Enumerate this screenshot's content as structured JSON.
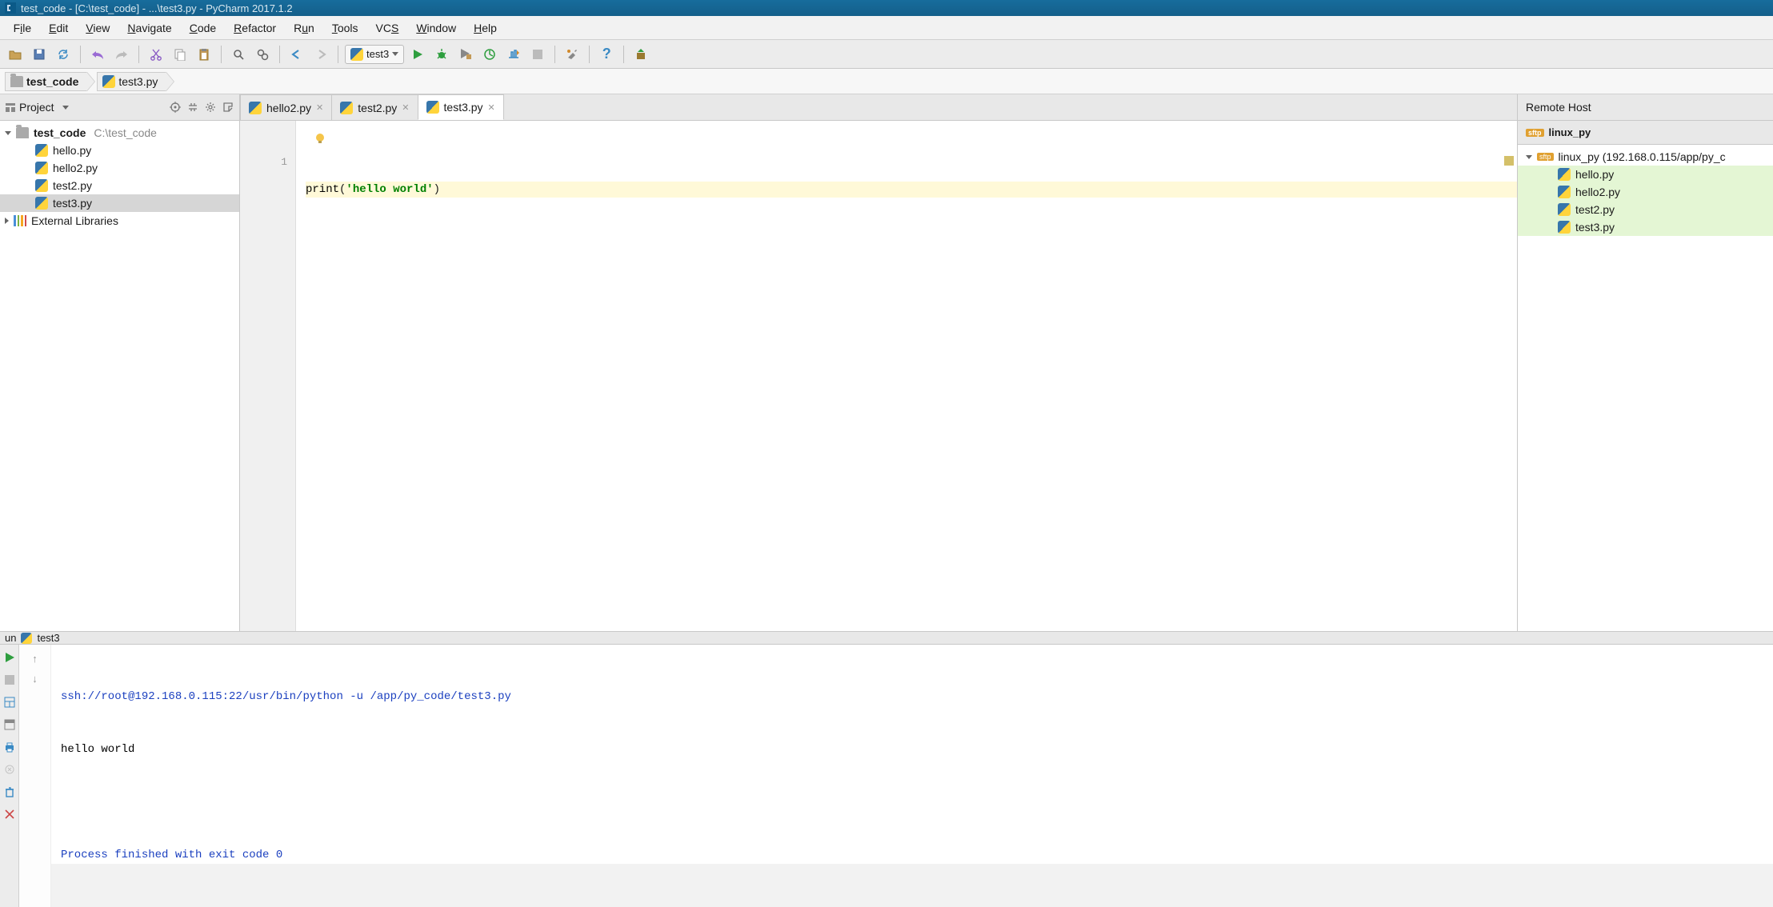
{
  "titlebar": {
    "text": "test_code - [C:\\test_code] - ...\\test3.py - PyCharm 2017.1.2"
  },
  "menubar": {
    "items": [
      "File",
      "Edit",
      "View",
      "Navigate",
      "Code",
      "Refactor",
      "Run",
      "Tools",
      "VCS",
      "Window",
      "Help"
    ]
  },
  "toolbar": {
    "run_config": "test3"
  },
  "breadcrumb": {
    "items": [
      {
        "label": "test_code",
        "type": "folder"
      },
      {
        "label": "test3.py",
        "type": "py"
      }
    ]
  },
  "project": {
    "title": "Project",
    "root": {
      "name": "test_code",
      "path": "C:\\test_code"
    },
    "files": [
      "hello.py",
      "hello2.py",
      "test2.py",
      "test3.py"
    ],
    "selected": "test3.py",
    "external": "External Libraries"
  },
  "editor": {
    "tabs": [
      {
        "label": "hello2.py",
        "active": false
      },
      {
        "label": "test2.py",
        "active": false
      },
      {
        "label": "test3.py",
        "active": true
      }
    ],
    "line_numbers": [
      "1"
    ],
    "code": {
      "fn": "print",
      "paren_open": "(",
      "str": "'hello world'",
      "paren_close": ")"
    }
  },
  "remote": {
    "header": "Remote Host",
    "host_label": "linux_py",
    "root": "linux_py (192.168.0.115/app/py_c",
    "files": [
      "hello.py",
      "hello2.py",
      "test2.py",
      "test3.py"
    ]
  },
  "run": {
    "tab_label_prefix": "un",
    "tab_name": "test3",
    "cmd": "ssh://root@192.168.0.115:22/usr/bin/python -u /app/py_code/test3.py",
    "out": "hello world",
    "exit": "Process finished with exit code 0"
  }
}
